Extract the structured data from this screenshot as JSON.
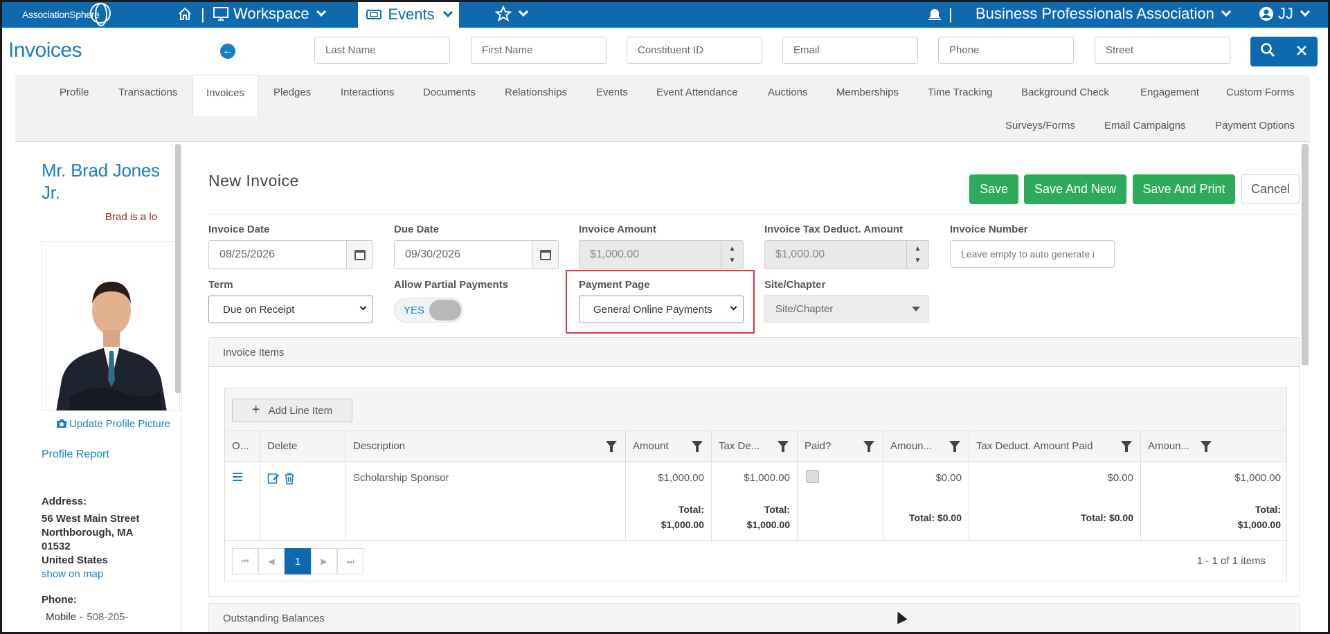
{
  "colors": {
    "brand": "#0e6aae",
    "link": "#1a7fc4",
    "save": "#2eaa5b",
    "highlight": "#d9363e",
    "note": "#a8222a"
  },
  "topnav": {
    "logo": "AssociationSphere",
    "workspace_label": "Workspace",
    "events_label": "Events",
    "org_name": "Business Professionals Association",
    "user_initials": "JJ",
    "sep": "|"
  },
  "header": {
    "title": "Invoices",
    "search_fields": [
      "Last Name",
      "First Name",
      "Constituent ID",
      "Email",
      "Phone",
      "Street"
    ]
  },
  "tabs": {
    "row1": [
      "Profile",
      "Transactions",
      "Invoices",
      "Pledges",
      "Interactions",
      "Documents",
      "Relationships",
      "Events",
      "Event Attendance",
      "Auctions",
      "Memberships",
      "Time Tracking",
      "Background Check",
      "Engagement",
      "Custom Forms"
    ],
    "row2": [
      "Surveys/Forms",
      "Email Campaigns",
      "Payment Options"
    ],
    "active": "Invoices"
  },
  "profile": {
    "name": "Mr. Brad Jones Jr.",
    "note": "Brad is a lo",
    "update_picture": "Update Profile Picture",
    "report_link": "Profile Report",
    "address_label": "Address:",
    "address_line1": "56 West Main Street",
    "address_line2": "Northborough, MA",
    "address_line3": "01532",
    "address_line4": "United States",
    "map_link": "show on map",
    "phone_label": "Phone:",
    "phone_type": "Mobile -",
    "phone_number": "508-205-"
  },
  "form": {
    "heading": "New Invoice",
    "buttons": {
      "save": "Save",
      "save_new": "Save And New",
      "save_print": "Save And Print",
      "cancel": "Cancel"
    },
    "invoice_date_label": "Invoice Date",
    "invoice_date": "08/25/2026",
    "due_date_label": "Due Date",
    "due_date": "09/30/2026",
    "invoice_amount_label": "Invoice Amount",
    "invoice_amount": "$1,000.00",
    "tax_label": "Invoice Tax Deduct. Amount",
    "tax_amount": "$1,000.00",
    "invoice_number_label": "Invoice Number",
    "invoice_number_placeholder": "Leave empty to auto generate i",
    "term_label": "Term",
    "term_value": "Due on Receipt",
    "partial_label": "Allow Partial Payments",
    "partial_value": "YES",
    "payment_page_label": "Payment Page",
    "payment_page_value": "General Online Payments",
    "site_label": "Site/Chapter",
    "site_value": "Site/Chapter"
  },
  "items": {
    "panel_title": "Invoice Items",
    "add_button": "Add Line Item",
    "columns": [
      "O...",
      "Delete",
      "Description",
      "Amount",
      "Tax De...",
      "Paid?",
      "Amoun...",
      "Tax Deduct. Amount Paid",
      "Amoun..."
    ],
    "row": {
      "description": "Scholarship Sponsor",
      "amount": "$1,000.00",
      "tax": "$1,000.00",
      "amount_paid": "$0.00",
      "tax_paid": "$0.00",
      "amount_due": "$1,000.00"
    },
    "totals": {
      "label": "Total:",
      "amount": "$1,000.00",
      "tax": "$1,000.00",
      "amount_paid": "Total: $0.00",
      "tax_paid": "Total: $0.00",
      "amount_due": "$1,000.00"
    },
    "pager": {
      "current_page": "1",
      "info": "1 - 1 of 1 items"
    }
  },
  "outstanding": {
    "title": "Outstanding Balances"
  }
}
